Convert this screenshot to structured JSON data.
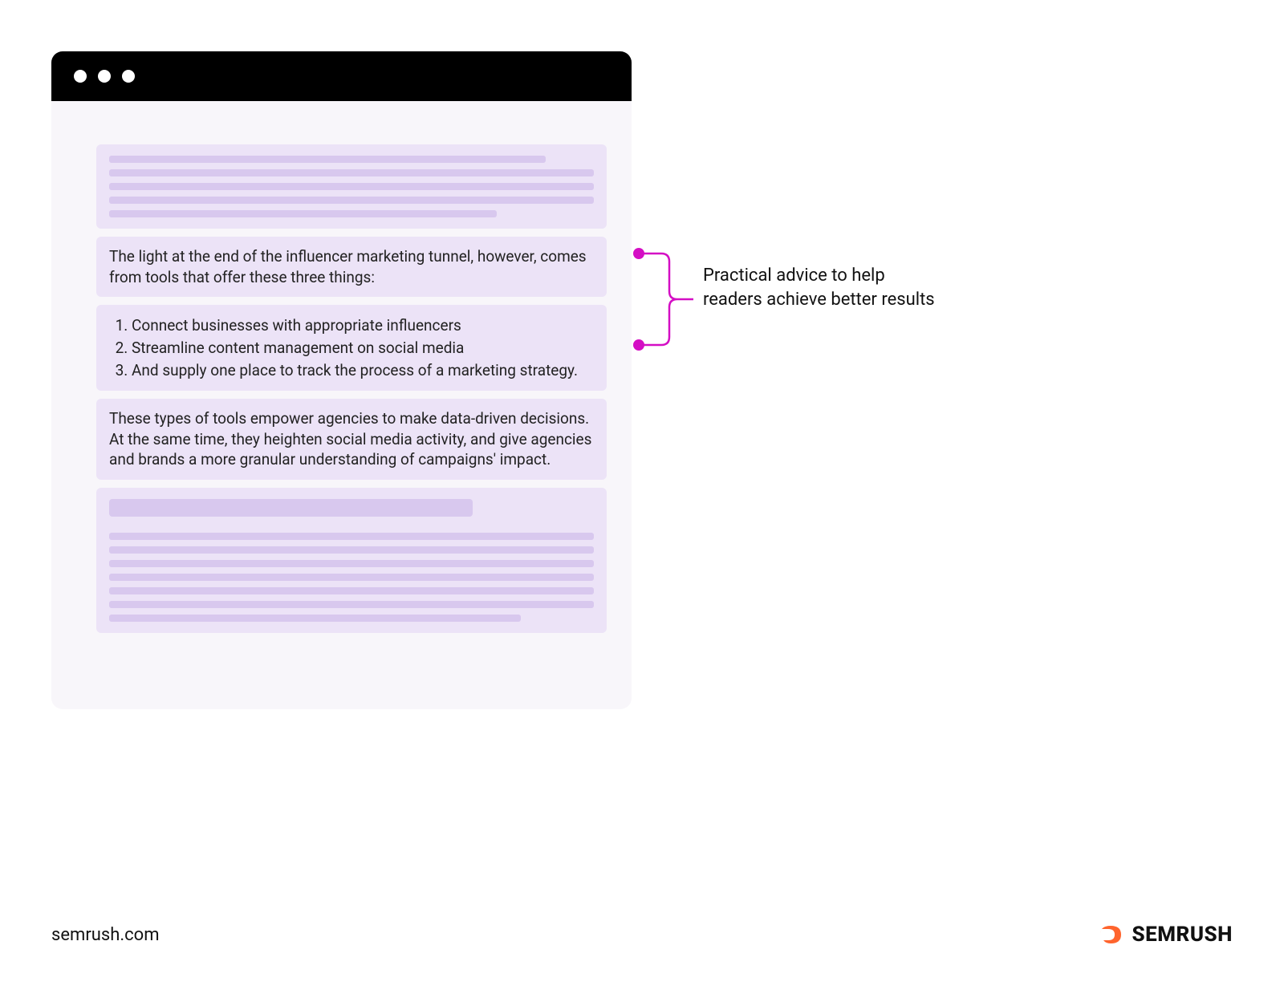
{
  "article": {
    "intro_paragraph": "The light at the end of the influencer marketing tunnel, however, comes from tools that offer these three things:",
    "list_items": [
      "Connect businesses with appropriate influencers",
      "Streamline content management on social media",
      "And supply one place to track the process of a marketing strategy."
    ],
    "closing_paragraph": "These types of tools empower agencies to make data-driven decisions. At the same time, they heighten social media activity, and give agencies and brands a more granular understanding of campaigns' impact."
  },
  "annotation": {
    "label": "Practical advice to help readers achieve better results"
  },
  "footer": {
    "url": "semrush.com",
    "brand": "SEMRUSH"
  },
  "colors": {
    "block_bg": "#ece3f7",
    "skeleton": "#d8c8ee",
    "panel_bg": "#f8f6fa",
    "callout": "#d40ec4",
    "brand": "#ff642d"
  }
}
